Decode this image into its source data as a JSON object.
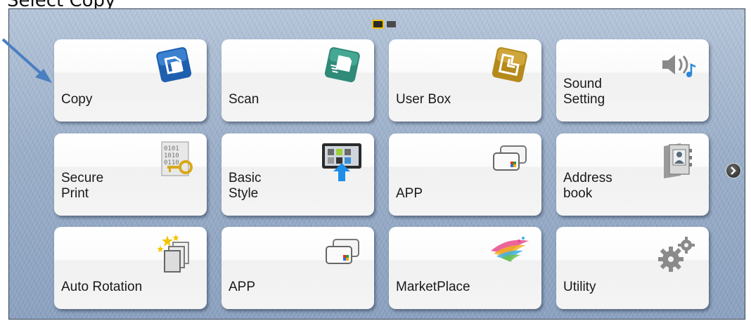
{
  "caption": "Select Copy",
  "pager": {
    "pages": 2,
    "current": 1
  },
  "tiles": [
    {
      "label": "Copy",
      "icon": "copy-icon"
    },
    {
      "label": "Scan",
      "icon": "scan-icon"
    },
    {
      "label": "User Box",
      "icon": "user-box-icon"
    },
    {
      "label": "Sound\nSetting",
      "icon": "speaker-icon"
    },
    {
      "label": "Secure\nPrint",
      "icon": "secure-print-icon"
    },
    {
      "label": "Basic\nStyle",
      "icon": "basic-style-icon"
    },
    {
      "label": "APP",
      "icon": "app-icon"
    },
    {
      "label": "Address\nbook",
      "icon": "address-book-icon"
    },
    {
      "label": "Auto Rotation",
      "icon": "auto-rotation-icon"
    },
    {
      "label": "APP",
      "icon": "app-icon"
    },
    {
      "label": "MarketPlace",
      "icon": "marketplace-icon"
    },
    {
      "label": "Utility",
      "icon": "gear-icon"
    }
  ],
  "colors": {
    "copy": "#1f5fb0",
    "scan": "#2f8a78",
    "userbox": "#b58a1a",
    "accent": "#f0c000",
    "arrow": "#4a7fc1"
  }
}
